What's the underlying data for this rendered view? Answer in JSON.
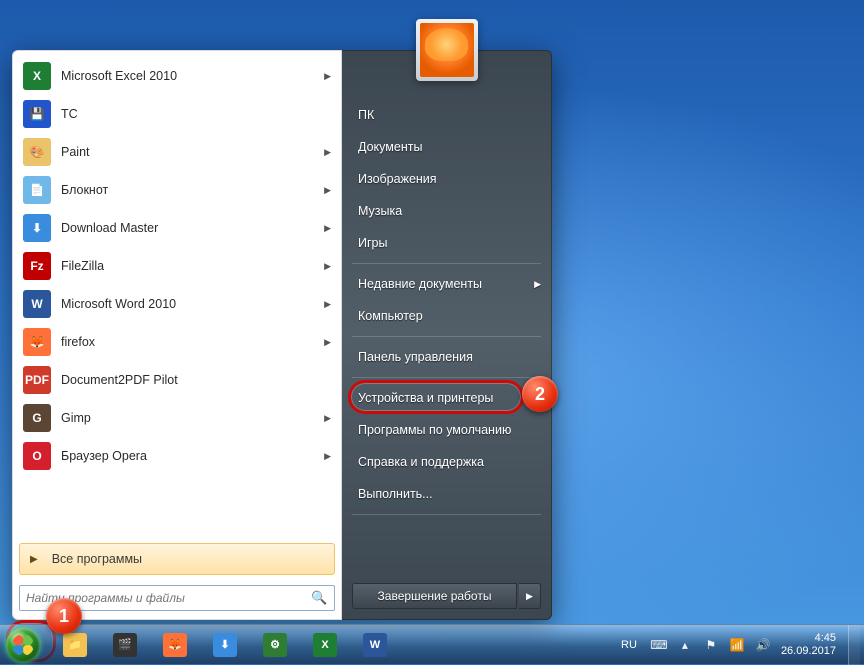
{
  "start_menu": {
    "pinned": [
      {
        "label": "Microsoft Excel 2010",
        "icon": "excel",
        "bg": "#1e7e34",
        "glyph": "X",
        "submenu": true
      },
      {
        "label": "TC",
        "icon": "tc",
        "bg": "#2255cc",
        "glyph": "💾",
        "submenu": false
      },
      {
        "label": "Paint",
        "icon": "paint",
        "bg": "#e9c46a",
        "glyph": "🎨",
        "submenu": true
      },
      {
        "label": "Блокнот",
        "icon": "notepad",
        "bg": "#6fb8e8",
        "glyph": "📄",
        "submenu": true
      },
      {
        "label": "Download Master",
        "icon": "dm",
        "bg": "#3a8dde",
        "glyph": "⬇",
        "submenu": true
      },
      {
        "label": "FileZilla",
        "icon": "filezilla",
        "bg": "#c00000",
        "glyph": "Fz",
        "submenu": true
      },
      {
        "label": "Microsoft Word 2010",
        "icon": "word",
        "bg": "#2b579a",
        "glyph": "W",
        "submenu": true
      },
      {
        "label": "firefox",
        "icon": "firefox",
        "bg": "#ff7139",
        "glyph": "🦊",
        "submenu": true
      },
      {
        "label": "Document2PDF Pilot",
        "icon": "pdf",
        "bg": "#d03a2b",
        "glyph": "PDF",
        "submenu": false
      },
      {
        "label": "Gimp",
        "icon": "gimp",
        "bg": "#5b4636",
        "glyph": "G",
        "submenu": true
      },
      {
        "label": "Браузер Opera",
        "icon": "opera",
        "bg": "#d4202c",
        "glyph": "O",
        "submenu": true
      }
    ],
    "all_programs": "Все программы",
    "search_placeholder": "Найти программы и файлы",
    "right": [
      {
        "label": "ПК",
        "key": "pc"
      },
      {
        "label": "Документы",
        "key": "documents"
      },
      {
        "label": "Изображения",
        "key": "pictures"
      },
      {
        "label": "Музыка",
        "key": "music"
      },
      {
        "label": "Игры",
        "key": "games"
      },
      {
        "label": "Недавние документы",
        "key": "recent",
        "submenu": true
      },
      {
        "label": "Компьютер",
        "key": "computer"
      },
      {
        "label": "Панель управления",
        "key": "control_panel",
        "highlighted": true
      },
      {
        "label": "Устройства и принтеры",
        "key": "devices"
      },
      {
        "label": "Программы по умолчанию",
        "key": "default_programs"
      },
      {
        "label": "Справка и поддержка",
        "key": "help"
      },
      {
        "label": "Выполнить...",
        "key": "run"
      }
    ],
    "shutdown": "Завершение работы"
  },
  "taskbar": {
    "pinned": [
      {
        "name": "explorer",
        "bg": "#f4c252",
        "glyph": "📁"
      },
      {
        "name": "mpc",
        "bg": "#333",
        "glyph": "🎬"
      },
      {
        "name": "firefox",
        "bg": "#ff7139",
        "glyph": "🦊"
      },
      {
        "name": "downloadmaster",
        "bg": "#3a8dde",
        "glyph": "⬇"
      },
      {
        "name": "settings",
        "bg": "#2e7d32",
        "glyph": "⚙"
      },
      {
        "name": "excel",
        "bg": "#1e7e34",
        "glyph": "X"
      },
      {
        "name": "word",
        "bg": "#2b579a",
        "glyph": "W"
      }
    ],
    "lang": "RU",
    "time": "4:45",
    "date": "26.09.2017"
  },
  "callouts": {
    "one": "1",
    "two": "2"
  }
}
